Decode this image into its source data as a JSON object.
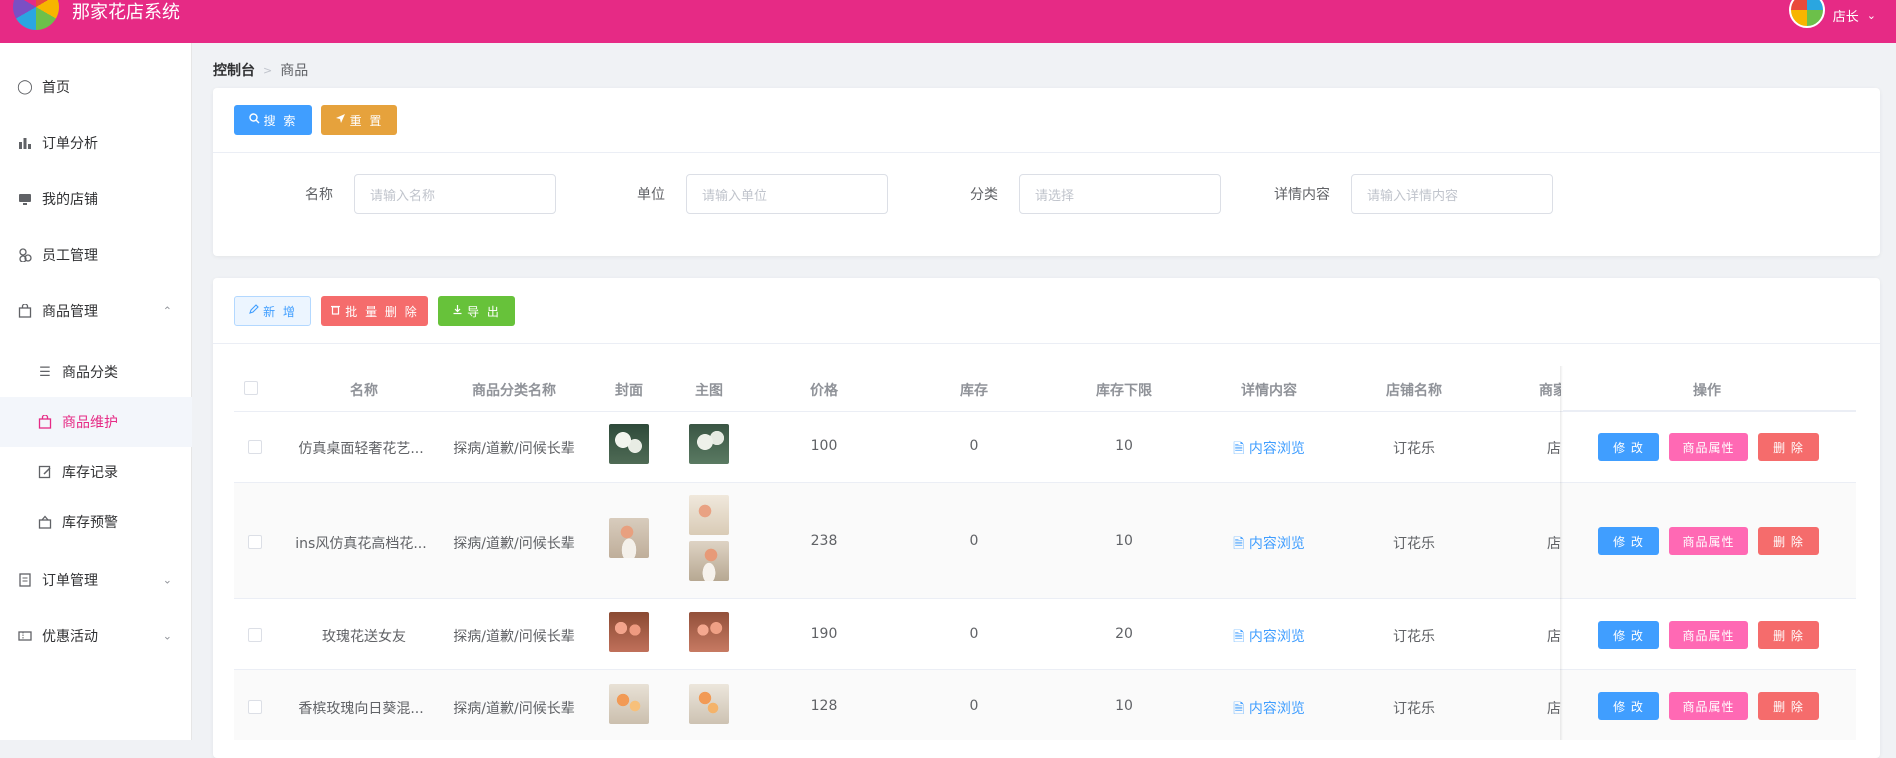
{
  "app": {
    "title": "那家花店系统",
    "user": "店长"
  },
  "sidebar": {
    "items": [
      {
        "label": "首页",
        "icon": "home-icon"
      },
      {
        "label": "订单分析",
        "icon": "bar-chart-icon"
      },
      {
        "label": "我的店铺",
        "icon": "monitor-icon"
      },
      {
        "label": "员工管理",
        "icon": "users-icon"
      },
      {
        "label": "商品管理",
        "icon": "bag-icon"
      },
      {
        "label": "订单管理",
        "icon": "document-icon"
      },
      {
        "label": "优惠活动",
        "icon": "ticket-icon"
      }
    ],
    "sub": [
      {
        "label": "商品分类",
        "icon": "list-icon"
      },
      {
        "label": "商品维护",
        "icon": "bag-icon"
      },
      {
        "label": "库存记录",
        "icon": "edit-icon"
      },
      {
        "label": "库存预警",
        "icon": "alert-icon"
      }
    ]
  },
  "breadcrumb": {
    "root": "控制台",
    "current": "商品"
  },
  "search": {
    "search_label": "搜 索",
    "reset_label": "重 置",
    "fields": [
      {
        "label": "名称",
        "placeholder": "请输入名称"
      },
      {
        "label": "单位",
        "placeholder": "请输入单位"
      },
      {
        "label": "分类",
        "placeholder": "请选择"
      },
      {
        "label": "详情内容",
        "placeholder": "请输入详情内容"
      }
    ]
  },
  "toolbar": {
    "add_label": "新 增",
    "batch_delete_label": "批 量 删 除",
    "export_label": "导 出"
  },
  "colors": {
    "header": "#e62a85",
    "primary": "#409eff",
    "warning": "#e6a23c",
    "danger": "#f56c6c",
    "success": "#67c23a",
    "pink": "#ff69b4"
  },
  "table": {
    "headers": [
      "名称",
      "商品分类名称",
      "封面",
      "主图",
      "价格",
      "库存",
      "库存下限",
      "详情内容",
      "店铺名称",
      "商家",
      "操作"
    ],
    "rows": [
      {
        "name": "仿真桌面轻奢花艺...",
        "category": "探病/道歉/问候长辈",
        "price": "100",
        "stock": "0",
        "min_stock": "10",
        "detail": "内容浏览",
        "shop": "订花乐",
        "merchant": "店"
      },
      {
        "name": "ins风仿真花高档花...",
        "category": "探病/道歉/问候长辈",
        "price": "238",
        "stock": "0",
        "min_stock": "10",
        "detail": "内容浏览",
        "shop": "订花乐",
        "merchant": "店"
      },
      {
        "name": "玫瑰花送女友",
        "category": "探病/道歉/问候长辈",
        "price": "190",
        "stock": "0",
        "min_stock": "20",
        "detail": "内容浏览",
        "shop": "订花乐",
        "merchant": "店"
      },
      {
        "name": "香槟玫瑰向日葵混...",
        "category": "探病/道歉/问候长辈",
        "price": "128",
        "stock": "0",
        "min_stock": "10",
        "detail": "内容浏览",
        "shop": "订花乐",
        "merchant": "店"
      }
    ],
    "actions": {
      "edit": "修 改",
      "attr": "商品属性",
      "delete": "删 除"
    }
  }
}
